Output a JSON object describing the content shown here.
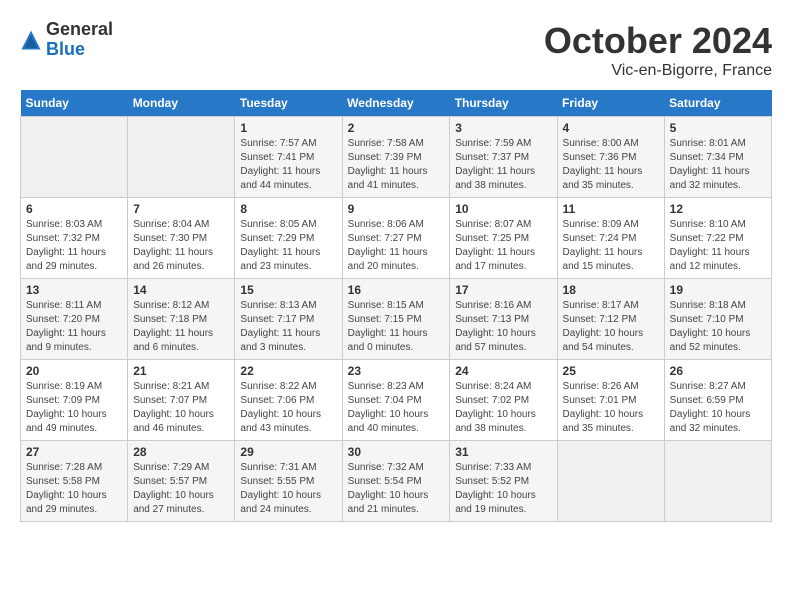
{
  "header": {
    "logo_general": "General",
    "logo_blue": "Blue",
    "month_title": "October 2024",
    "location": "Vic-en-Bigorre, France"
  },
  "days_of_week": [
    "Sunday",
    "Monday",
    "Tuesday",
    "Wednesday",
    "Thursday",
    "Friday",
    "Saturday"
  ],
  "weeks": [
    [
      {
        "day": "",
        "sunrise": "",
        "sunset": "",
        "daylight": ""
      },
      {
        "day": "",
        "sunrise": "",
        "sunset": "",
        "daylight": ""
      },
      {
        "day": "1",
        "sunrise": "Sunrise: 7:57 AM",
        "sunset": "Sunset: 7:41 PM",
        "daylight": "Daylight: 11 hours and 44 minutes."
      },
      {
        "day": "2",
        "sunrise": "Sunrise: 7:58 AM",
        "sunset": "Sunset: 7:39 PM",
        "daylight": "Daylight: 11 hours and 41 minutes."
      },
      {
        "day": "3",
        "sunrise": "Sunrise: 7:59 AM",
        "sunset": "Sunset: 7:37 PM",
        "daylight": "Daylight: 11 hours and 38 minutes."
      },
      {
        "day": "4",
        "sunrise": "Sunrise: 8:00 AM",
        "sunset": "Sunset: 7:36 PM",
        "daylight": "Daylight: 11 hours and 35 minutes."
      },
      {
        "day": "5",
        "sunrise": "Sunrise: 8:01 AM",
        "sunset": "Sunset: 7:34 PM",
        "daylight": "Daylight: 11 hours and 32 minutes."
      }
    ],
    [
      {
        "day": "6",
        "sunrise": "Sunrise: 8:03 AM",
        "sunset": "Sunset: 7:32 PM",
        "daylight": "Daylight: 11 hours and 29 minutes."
      },
      {
        "day": "7",
        "sunrise": "Sunrise: 8:04 AM",
        "sunset": "Sunset: 7:30 PM",
        "daylight": "Daylight: 11 hours and 26 minutes."
      },
      {
        "day": "8",
        "sunrise": "Sunrise: 8:05 AM",
        "sunset": "Sunset: 7:29 PM",
        "daylight": "Daylight: 11 hours and 23 minutes."
      },
      {
        "day": "9",
        "sunrise": "Sunrise: 8:06 AM",
        "sunset": "Sunset: 7:27 PM",
        "daylight": "Daylight: 11 hours and 20 minutes."
      },
      {
        "day": "10",
        "sunrise": "Sunrise: 8:07 AM",
        "sunset": "Sunset: 7:25 PM",
        "daylight": "Daylight: 11 hours and 17 minutes."
      },
      {
        "day": "11",
        "sunrise": "Sunrise: 8:09 AM",
        "sunset": "Sunset: 7:24 PM",
        "daylight": "Daylight: 11 hours and 15 minutes."
      },
      {
        "day": "12",
        "sunrise": "Sunrise: 8:10 AM",
        "sunset": "Sunset: 7:22 PM",
        "daylight": "Daylight: 11 hours and 12 minutes."
      }
    ],
    [
      {
        "day": "13",
        "sunrise": "Sunrise: 8:11 AM",
        "sunset": "Sunset: 7:20 PM",
        "daylight": "Daylight: 11 hours and 9 minutes."
      },
      {
        "day": "14",
        "sunrise": "Sunrise: 8:12 AM",
        "sunset": "Sunset: 7:18 PM",
        "daylight": "Daylight: 11 hours and 6 minutes."
      },
      {
        "day": "15",
        "sunrise": "Sunrise: 8:13 AM",
        "sunset": "Sunset: 7:17 PM",
        "daylight": "Daylight: 11 hours and 3 minutes."
      },
      {
        "day": "16",
        "sunrise": "Sunrise: 8:15 AM",
        "sunset": "Sunset: 7:15 PM",
        "daylight": "Daylight: 11 hours and 0 minutes."
      },
      {
        "day": "17",
        "sunrise": "Sunrise: 8:16 AM",
        "sunset": "Sunset: 7:13 PM",
        "daylight": "Daylight: 10 hours and 57 minutes."
      },
      {
        "day": "18",
        "sunrise": "Sunrise: 8:17 AM",
        "sunset": "Sunset: 7:12 PM",
        "daylight": "Daylight: 10 hours and 54 minutes."
      },
      {
        "day": "19",
        "sunrise": "Sunrise: 8:18 AM",
        "sunset": "Sunset: 7:10 PM",
        "daylight": "Daylight: 10 hours and 52 minutes."
      }
    ],
    [
      {
        "day": "20",
        "sunrise": "Sunrise: 8:19 AM",
        "sunset": "Sunset: 7:09 PM",
        "daylight": "Daylight: 10 hours and 49 minutes."
      },
      {
        "day": "21",
        "sunrise": "Sunrise: 8:21 AM",
        "sunset": "Sunset: 7:07 PM",
        "daylight": "Daylight: 10 hours and 46 minutes."
      },
      {
        "day": "22",
        "sunrise": "Sunrise: 8:22 AM",
        "sunset": "Sunset: 7:06 PM",
        "daylight": "Daylight: 10 hours and 43 minutes."
      },
      {
        "day": "23",
        "sunrise": "Sunrise: 8:23 AM",
        "sunset": "Sunset: 7:04 PM",
        "daylight": "Daylight: 10 hours and 40 minutes."
      },
      {
        "day": "24",
        "sunrise": "Sunrise: 8:24 AM",
        "sunset": "Sunset: 7:02 PM",
        "daylight": "Daylight: 10 hours and 38 minutes."
      },
      {
        "day": "25",
        "sunrise": "Sunrise: 8:26 AM",
        "sunset": "Sunset: 7:01 PM",
        "daylight": "Daylight: 10 hours and 35 minutes."
      },
      {
        "day": "26",
        "sunrise": "Sunrise: 8:27 AM",
        "sunset": "Sunset: 6:59 PM",
        "daylight": "Daylight: 10 hours and 32 minutes."
      }
    ],
    [
      {
        "day": "27",
        "sunrise": "Sunrise: 7:28 AM",
        "sunset": "Sunset: 5:58 PM",
        "daylight": "Daylight: 10 hours and 29 minutes."
      },
      {
        "day": "28",
        "sunrise": "Sunrise: 7:29 AM",
        "sunset": "Sunset: 5:57 PM",
        "daylight": "Daylight: 10 hours and 27 minutes."
      },
      {
        "day": "29",
        "sunrise": "Sunrise: 7:31 AM",
        "sunset": "Sunset: 5:55 PM",
        "daylight": "Daylight: 10 hours and 24 minutes."
      },
      {
        "day": "30",
        "sunrise": "Sunrise: 7:32 AM",
        "sunset": "Sunset: 5:54 PM",
        "daylight": "Daylight: 10 hours and 21 minutes."
      },
      {
        "day": "31",
        "sunrise": "Sunrise: 7:33 AM",
        "sunset": "Sunset: 5:52 PM",
        "daylight": "Daylight: 10 hours and 19 minutes."
      },
      {
        "day": "",
        "sunrise": "",
        "sunset": "",
        "daylight": ""
      },
      {
        "day": "",
        "sunrise": "",
        "sunset": "",
        "daylight": ""
      }
    ]
  ]
}
